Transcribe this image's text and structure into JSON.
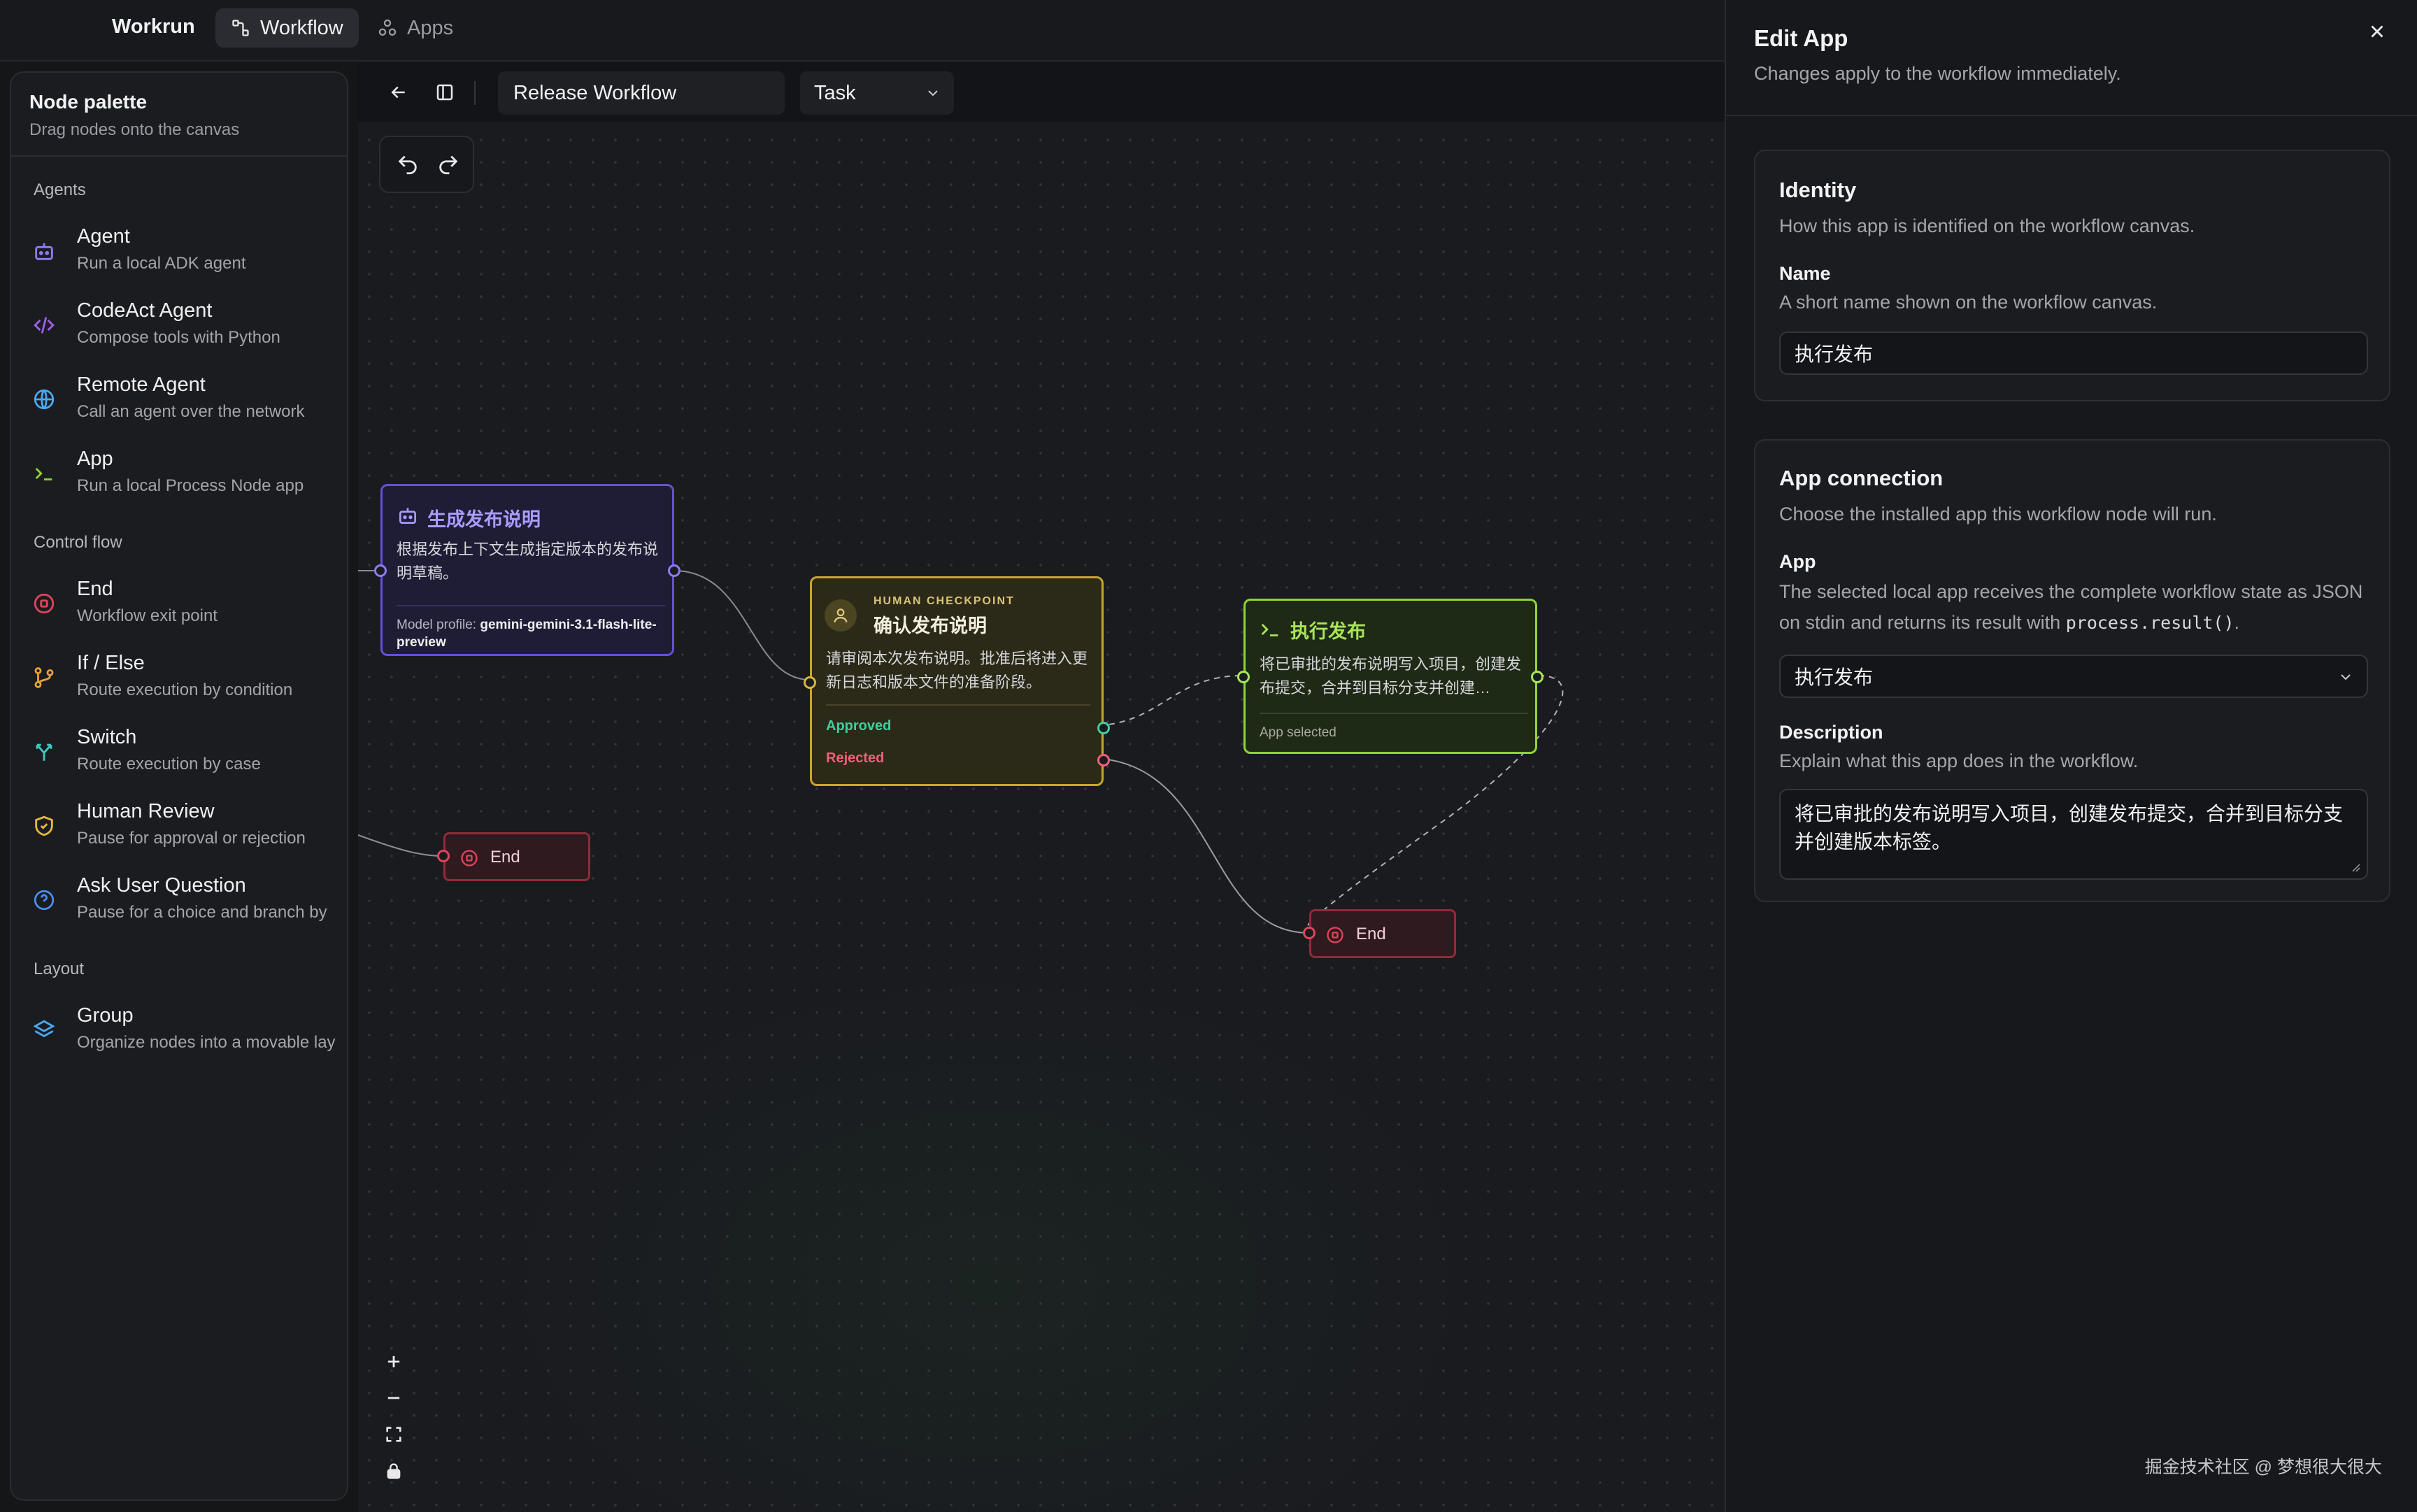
{
  "topbar": {
    "brand": "Workrun",
    "tabs": [
      {
        "label": "Workflow",
        "icon": "workflow-icon",
        "active": true
      },
      {
        "label": "Apps",
        "icon": "apps-icon",
        "active": false
      }
    ]
  },
  "palette": {
    "title": "Node palette",
    "subtitle": "Drag nodes onto the canvas",
    "sections": [
      {
        "label": "Agents",
        "items": [
          {
            "name": "Agent",
            "desc": "Run a local ADK agent",
            "icon": "robot-icon",
            "color": "#8b7cf6"
          },
          {
            "name": "CodeAct Agent",
            "desc": "Compose tools with Python",
            "icon": "code-icon",
            "color": "#a060f0"
          },
          {
            "name": "Remote Agent",
            "desc": "Call an agent over the network",
            "icon": "globe-icon",
            "color": "#4aa8f0"
          },
          {
            "name": "App",
            "desc": "Run a local Process Node app",
            "icon": "terminal-icon",
            "color": "#8fd436"
          }
        ]
      },
      {
        "label": "Control flow",
        "items": [
          {
            "name": "End",
            "desc": "Workflow exit point",
            "icon": "stop-icon",
            "color": "#e0455a"
          },
          {
            "name": "If / Else",
            "desc": "Route execution by condition",
            "icon": "branch-icon",
            "color": "#e6a23c"
          },
          {
            "name": "Switch",
            "desc": "Route execution by case",
            "icon": "split-icon",
            "color": "#3ec9c0"
          },
          {
            "name": "Human Review",
            "desc": "Pause for approval or rejection",
            "icon": "shield-icon",
            "color": "#e6b93c"
          },
          {
            "name": "Ask User Question",
            "desc": "Pause for a choice and branch by",
            "icon": "question-icon",
            "color": "#4a8cf0"
          }
        ]
      },
      {
        "label": "Layout",
        "items": [
          {
            "name": "Group",
            "desc": "Organize nodes into a movable lay",
            "icon": "layers-icon",
            "color": "#4aa8f0"
          }
        ]
      }
    ]
  },
  "canvas": {
    "workflow_name": "Release Workflow",
    "workflow_type": "Task",
    "nodes": {
      "agent": {
        "title": "生成发布说明",
        "text": "根据发布上下文生成指定版本的发布说明草稿。",
        "model_label": "Model profile:",
        "model_value": "gemini-gemini-3.1-flash-lite-preview"
      },
      "human": {
        "kicker": "HUMAN CHECKPOINT",
        "title": "确认发布说明",
        "text": "请审阅本次发布说明。批准后将进入更新日志和版本文件的准备阶段。",
        "approved": "Approved",
        "rejected": "Rejected"
      },
      "app": {
        "title": "执行发布",
        "text": "将已审批的发布说明写入项目，创建发布提交，合并到目标分支并创建…",
        "footer": "App selected"
      },
      "end1": {
        "title": "End"
      },
      "end2": {
        "title": "End"
      }
    },
    "colors": {
      "agent": "#6650d4",
      "human": "#c9a62a",
      "app": "#8fd436",
      "end": "#e0455a",
      "approved": "#3fcf9e",
      "rejected": "#f0607a"
    }
  },
  "panel": {
    "title": "Edit App",
    "subtitle": "Changes apply to the workflow immediately.",
    "identity": {
      "title": "Identity",
      "subtitle": "How this app is identified on the workflow canvas.",
      "name_label": "Name",
      "name_help": "A short name shown on the workflow canvas.",
      "name_value": "执行发布"
    },
    "connection": {
      "title": "App connection",
      "subtitle": "Choose the installed app this workflow node will run.",
      "app_label": "App",
      "app_help_1": "The selected local app receives the complete workflow state as JSON on stdin and returns its result with",
      "app_help_code": "process.result()",
      "app_help_2": ".",
      "app_value": "执行发布",
      "desc_label": "Description",
      "desc_help": "Explain what this app does in the workflow.",
      "desc_value": "将已审批的发布说明写入项目，创建发布提交，合并到目标分支并创建版本标签。"
    }
  },
  "watermark": "掘金技术社区 @ 梦想很大很大"
}
